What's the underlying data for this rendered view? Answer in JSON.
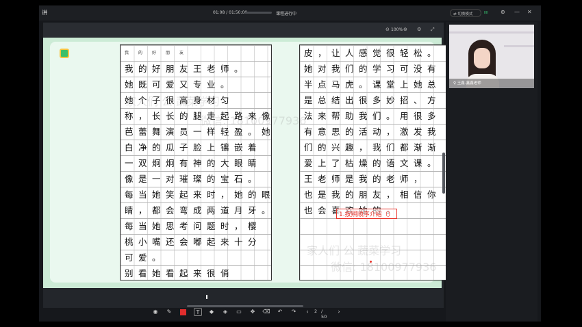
{
  "titlebar": {
    "title": "讲",
    "time": "01:08 / 01:50:00",
    "status": "课程进行中",
    "mode_label": "⇄ 切换模式",
    "signal": "IIII"
  },
  "stage": {
    "zoom": "100%"
  },
  "sheet_left": {
    "lines": [
      "我的好朋友",
      "  我的好朋友王老师。",
      "她既可爱又专业。",
      "  她个子很高身材匀",
      "称，长长的腿走起路来像",
      "芭蕾舞演员一样轻盈。她",
      "白净的瓜子脸上镶嵌着",
      "一双炯炯有神的大眼睛",
      "像是一对璀璨的宝石。",
      "每当她笑起来时，她的眼",
      "睛，都会弯成两道月牙。",
      "每当她思考问题时，樱",
      "桃小嘴还会嘟起来十分",
      "可爱。",
      "  别看她看起来很俏"
    ]
  },
  "sheet_right": {
    "lines": [
      "皮，让人感觉很轻松。",
      "她对我们的学习可没有",
      "半点马虎。课堂上她总",
      "是总结出很多妙招、方",
      "法来帮助我们。用很多",
      "有意思的活动，激发我",
      "们的兴趣，我们都渐渐",
      "爱上了枯燥的语文课。",
      "  王老师是我的老师，",
      "也是我的朋友，相信你",
      "也会喜欢她的。"
    ],
    "annotation": "1.按照顺序介绍（）"
  },
  "watermarks": [
    "家人们 公 蔬菜学习",
    "微信: 18100977936",
    "家人们 公 蔬菜学习",
    "微信: 18100977936"
  ],
  "pager": {
    "current": "2",
    "total": "/ 50"
  },
  "video": {
    "name": "♀ 王鑫-鑫鑫老师"
  },
  "colors": {
    "page_green": "#ccebd6",
    "annotation_red": "#e8332a"
  }
}
